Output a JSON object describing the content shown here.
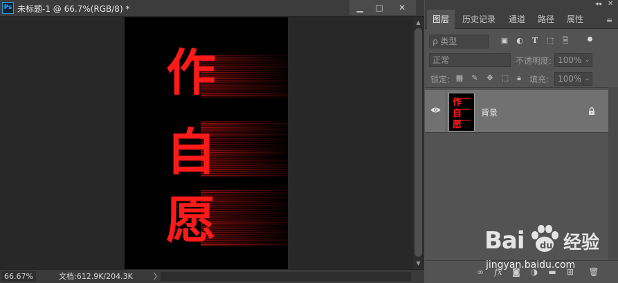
{
  "document": {
    "app_logo": "Ps",
    "title": "未标题-1 @ 66.7%(RGB/8) *",
    "window_buttons": {
      "minimize": "▁",
      "maximize": "□",
      "close": "✕"
    },
    "status": {
      "zoom": "66.67%",
      "doc_info": "文档:612.9K/204.3K",
      "arrow": "〉"
    },
    "canvas_text": [
      "作",
      "自",
      "愿"
    ]
  },
  "panel": {
    "tabs": [
      "图层",
      "历史记录",
      "通道",
      "路径",
      "属性"
    ],
    "active_tab": "图层",
    "filter": {
      "placeholder": "ρ 类型",
      "icons": [
        "image-icon",
        "adjustment-icon",
        "type-icon",
        "shape-icon",
        "smart-object-icon"
      ]
    },
    "blend_mode": "正常",
    "opacity_label": "不透明度:",
    "opacity_value": "100%",
    "lock_label": "锁定:",
    "lock_icons": [
      "lock-pixels-icon",
      "lock-brush-icon",
      "lock-move-icon",
      "lock-artboard-icon",
      "lock-all-icon"
    ],
    "fill_label": "填充:",
    "fill_value": "100%",
    "layers": [
      {
        "name": "背景",
        "visible": true,
        "locked": true
      }
    ],
    "bottom_icons": [
      "link-icon",
      "fx-icon",
      "mask-icon",
      "adjustment-layer-icon",
      "group-icon",
      "new-layer-icon",
      "trash-icon"
    ]
  },
  "watermark": {
    "brand": "Bai",
    "brand2": "经验",
    "url": "jingyan.baidu.com"
  },
  "colors": {
    "glyph": "#ff1a1a",
    "canvas_bg": "#000000",
    "ps_blue": "#31a8ff"
  }
}
